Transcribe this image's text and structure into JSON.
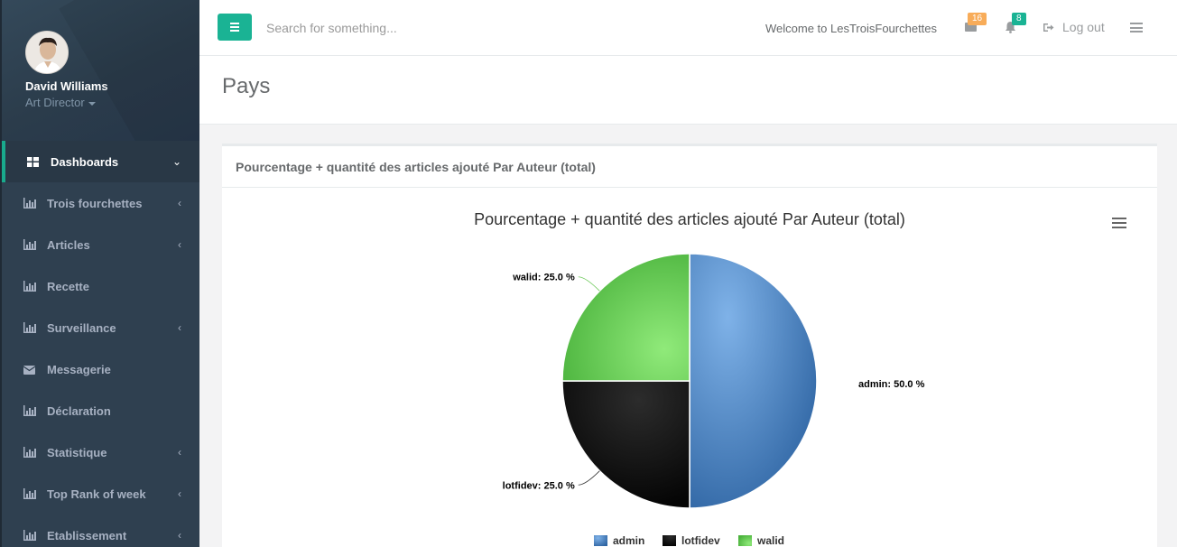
{
  "profile": {
    "name": "David Williams",
    "role": "Art Director"
  },
  "nav": [
    {
      "label": "Dashboards",
      "icon": "grid-icon",
      "arrow": "⌄",
      "active": true
    },
    {
      "label": "Trois fourchettes",
      "icon": "bar-chart-icon",
      "arrow": "‹"
    },
    {
      "label": "Articles",
      "icon": "bar-chart-icon",
      "arrow": "‹"
    },
    {
      "label": "Recette",
      "icon": "bar-chart-icon",
      "arrow": ""
    },
    {
      "label": "Surveillance",
      "icon": "bar-chart-icon",
      "arrow": "‹"
    },
    {
      "label": "Messagerie",
      "icon": "envelope-icon",
      "arrow": ""
    },
    {
      "label": "Déclaration",
      "icon": "bar-chart-icon",
      "arrow": ""
    },
    {
      "label": "Statistique",
      "icon": "bar-chart-icon",
      "arrow": "‹"
    },
    {
      "label": "Top Rank of week",
      "icon": "bar-chart-icon",
      "arrow": "‹"
    },
    {
      "label": "Etablissement",
      "icon": "bar-chart-icon",
      "arrow": "‹"
    }
  ],
  "topbar": {
    "search_placeholder": "Search for something...",
    "welcome": "Welcome to LesTroisFourchettes",
    "messages_count": "16",
    "notifications_count": "8",
    "logout_label": "Log out"
  },
  "page": {
    "title": "Pays"
  },
  "panel": {
    "title": "Pourcentage + quantité des articles ajouté Par Auteur (total)"
  },
  "colors": {
    "accent": "#1ab394",
    "sidebar": "#2f4050",
    "admin": "#4a86c5",
    "lotfidev": "#1a1a1a",
    "walid": "#6cc95a"
  },
  "chart_data": {
    "type": "pie",
    "title": "Pourcentage + quantité des articles ajouté Par Auteur (total)",
    "series": [
      {
        "name": "admin",
        "value": 50.0,
        "label": "admin: 50.0 %"
      },
      {
        "name": "lotfidev",
        "value": 25.0,
        "label": "lotfidev: 25.0 %"
      },
      {
        "name": "walid",
        "value": 25.0,
        "label": "walid: 25.0 %"
      }
    ],
    "legend": "bottom-center"
  }
}
